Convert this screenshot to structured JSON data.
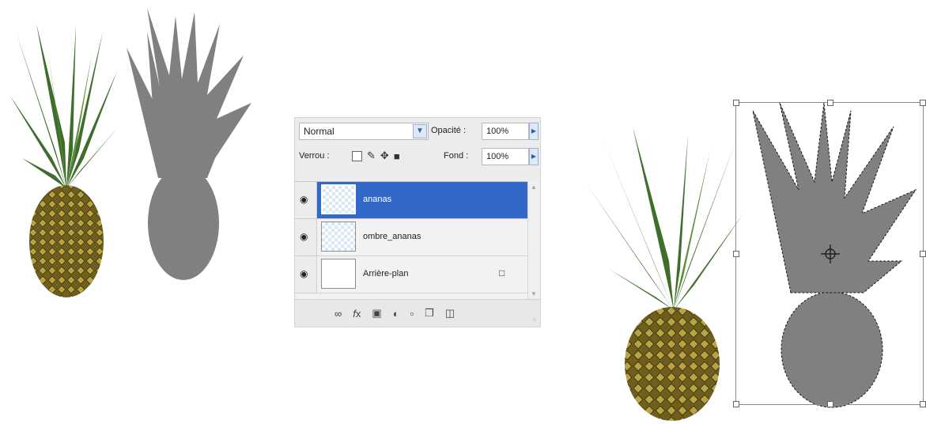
{
  "layers_panel": {
    "blend_mode": "Normal",
    "opacity_label": "Opacité :",
    "opacity_value": "100%",
    "lock_label": "Verrou :",
    "fill_label": "Fond :",
    "fill_value": "100%",
    "layers": [
      {
        "name": "ananas",
        "selected": true,
        "locked": false
      },
      {
        "name": "ombre_ananas",
        "selected": false,
        "locked": false
      },
      {
        "name": "Arrière-plan",
        "selected": false,
        "locked": true
      }
    ],
    "footer_tools": [
      "link-icon",
      "fx-icon",
      "mask-icon",
      "adjustment-icon",
      "folder-icon",
      "new-layer-icon",
      "trash-icon"
    ]
  },
  "colors": {
    "selection": "#3268c8",
    "shadow_gray": "#808080",
    "leaf_green": "#3f6e2c",
    "fruit_gold": "#8a7a2c"
  }
}
